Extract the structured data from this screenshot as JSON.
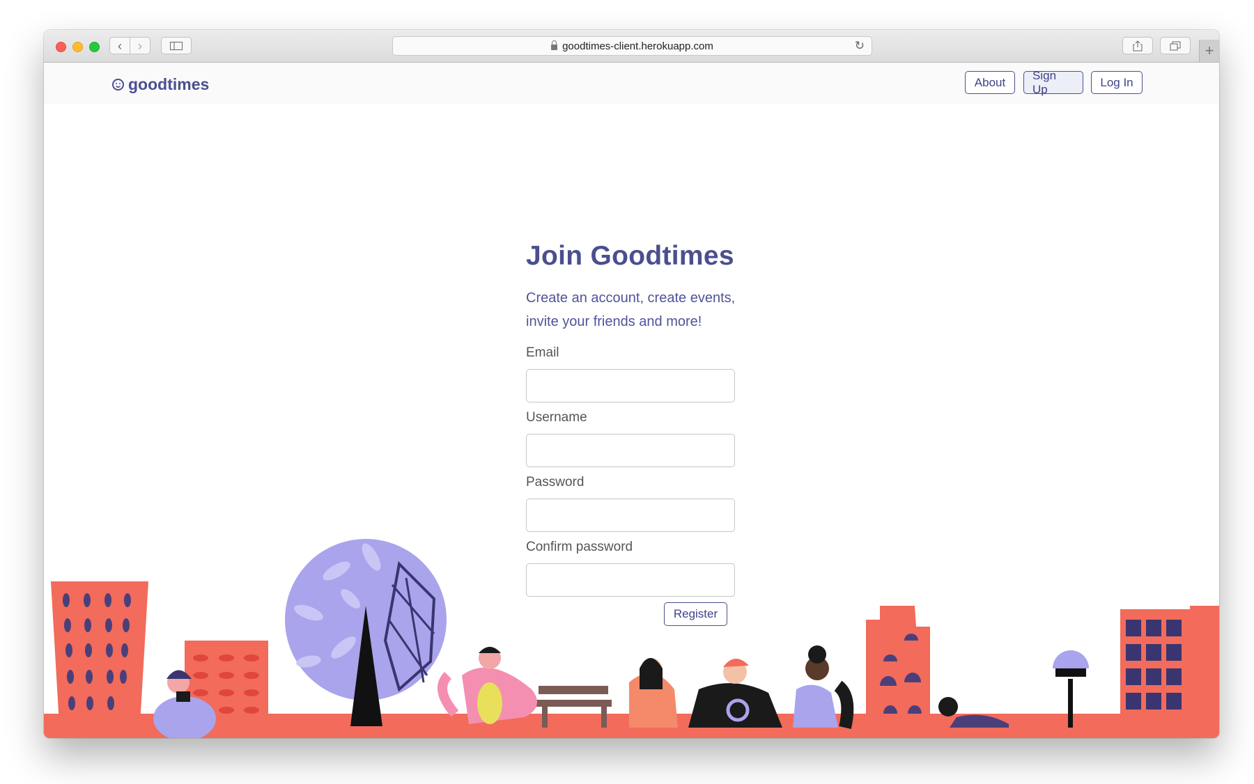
{
  "browser": {
    "url": "goodtimes-client.herokuapp.com"
  },
  "navbar": {
    "brand": "goodtimes",
    "links": [
      {
        "label": "About"
      },
      {
        "label": "Sign Up"
      },
      {
        "label": "Log In"
      }
    ]
  },
  "form": {
    "title": "Join Goodtimes",
    "subtitle": "Create an account, create events, invite your friends and more!",
    "fields": [
      {
        "label": "Email",
        "value": ""
      },
      {
        "label": "Username",
        "value": ""
      },
      {
        "label": "Password",
        "value": ""
      },
      {
        "label": "Confirm password",
        "value": ""
      }
    ],
    "submit_label": "Register"
  },
  "colors": {
    "brand": "#4b4f8f",
    "coral": "#f26b5b",
    "lavender": "#a9a4ec"
  },
  "icons": [
    "back-icon",
    "forward-icon",
    "sidebar-icon",
    "lock-icon",
    "reload-icon",
    "share-icon",
    "tabs-icon",
    "smiley-icon"
  ]
}
